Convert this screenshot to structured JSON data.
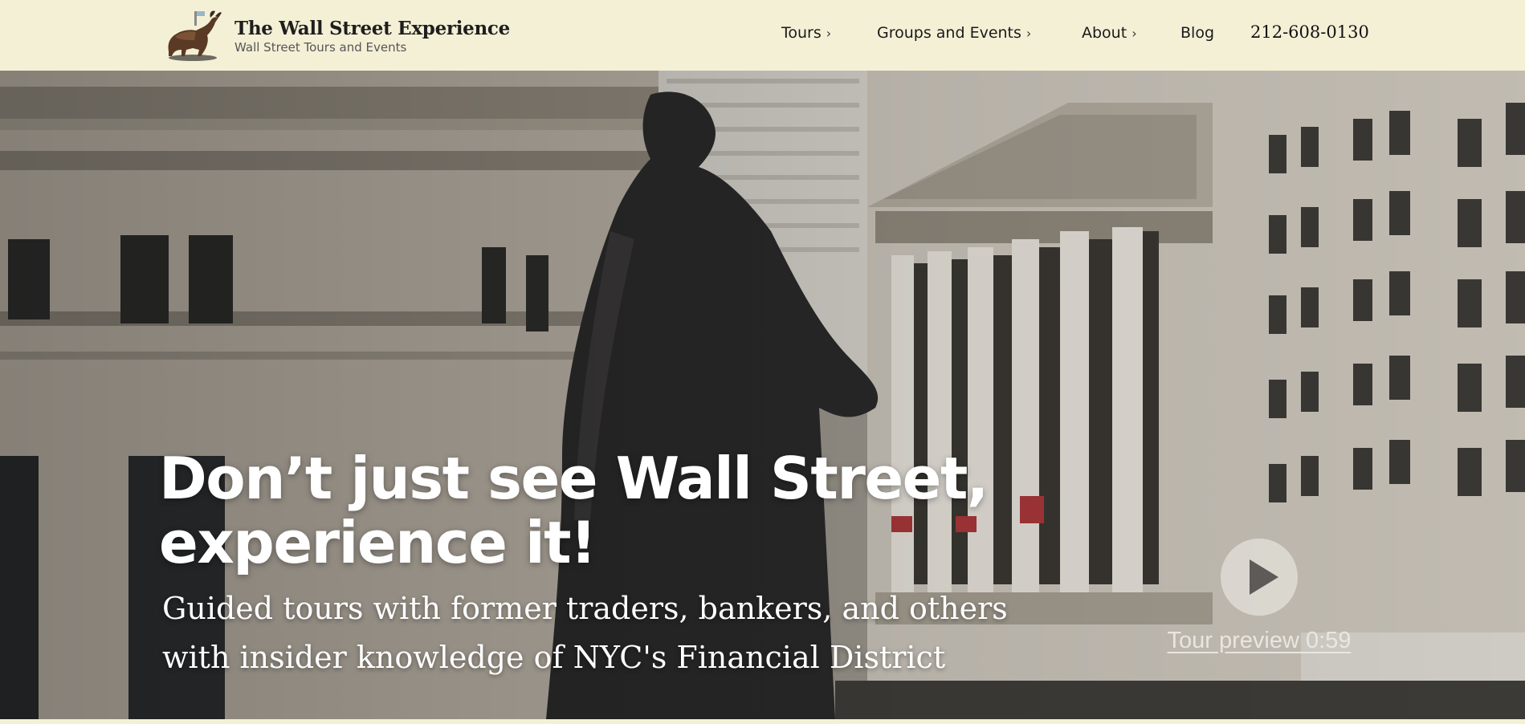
{
  "header": {
    "brand_title": "The Wall Street Experience",
    "brand_subtitle": "Wall Street Tours and Events",
    "logo_icon": "bull-statue-icon",
    "nav": [
      {
        "label": "Tours",
        "has_submenu": true
      },
      {
        "label": "Groups and Events",
        "has_submenu": true
      },
      {
        "label": "About",
        "has_submenu": true
      },
      {
        "label": "Blog",
        "has_submenu": false
      }
    ],
    "phone": "212-608-0130",
    "background": "#f4f0d6"
  },
  "hero": {
    "headline_line1": "Don’t just see Wall Street,",
    "headline_line2": "experience it!",
    "subhead_line1": "Guided tours with former traders, bankers, and others",
    "subhead_line2": "with insider knowledge of NYC's Financial District",
    "play_icon": "play-icon",
    "preview_label": "Tour preview 0:59"
  }
}
